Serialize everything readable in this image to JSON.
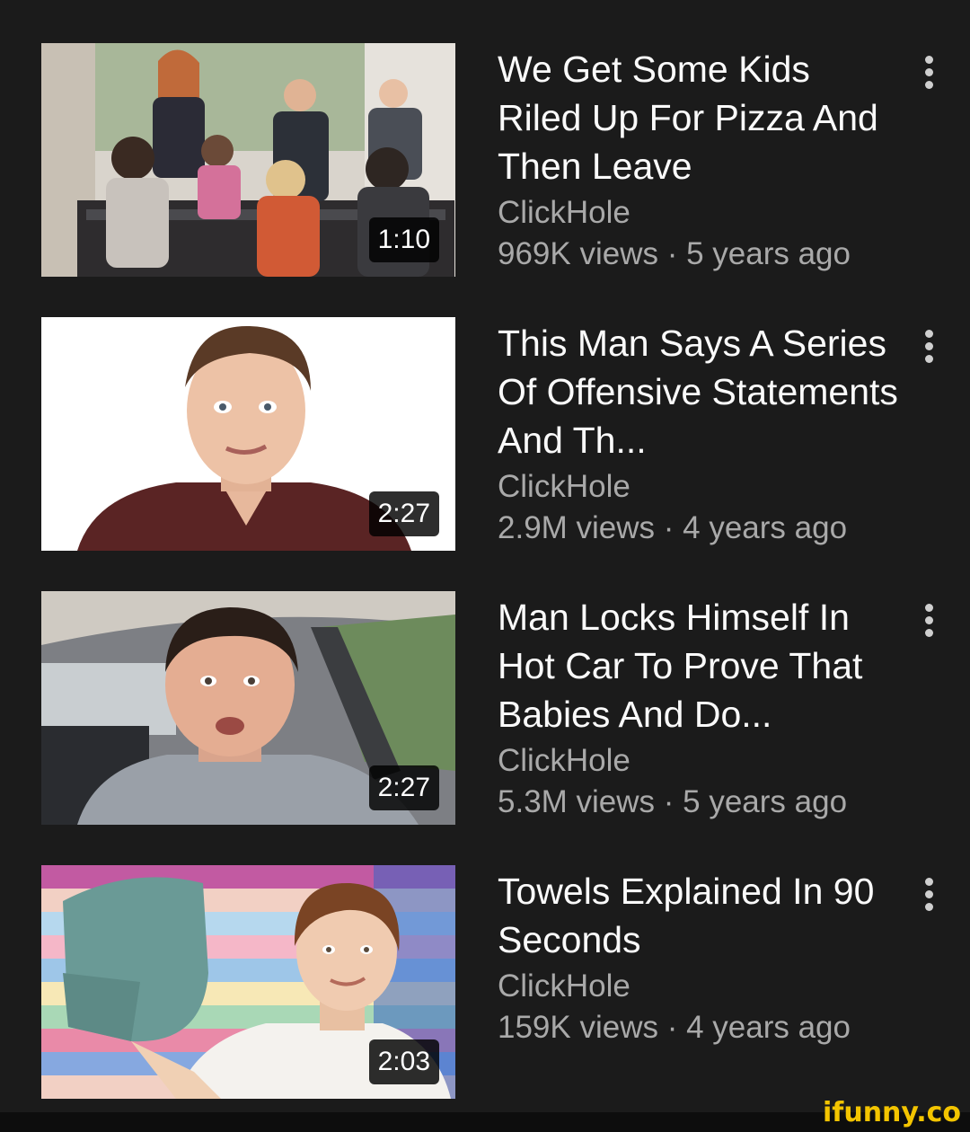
{
  "videos": [
    {
      "title": "We Get Some Kids Riled Up For Pizza And Then Leave",
      "channel": "ClickHole",
      "stats": "969K views · 5 years ago",
      "duration": "1:10",
      "menu_icon": "more-vert-icon"
    },
    {
      "title": "This Man Says A Series Of Offensive Statements And Th...",
      "channel": "ClickHole",
      "stats": "2.9M views · 4 years ago",
      "duration": "2:27",
      "menu_icon": "more-vert-icon"
    },
    {
      "title": "Man Locks Himself In Hot Car To Prove That Babies And Do...",
      "channel": "ClickHole",
      "stats": "5.3M views · 5 years ago",
      "duration": "2:27",
      "menu_icon": "more-vert-icon"
    },
    {
      "title": "Towels Explained In 90 Seconds",
      "channel": "ClickHole",
      "stats": "159K views · 4 years ago",
      "duration": "2:03",
      "menu_icon": "more-vert-icon"
    }
  ],
  "watermark": "ifunny.co",
  "colors": {
    "background": "#1b1b1b",
    "title_text": "#fafafa",
    "meta_text": "#a9a9a9",
    "watermark": "#f3c400"
  }
}
